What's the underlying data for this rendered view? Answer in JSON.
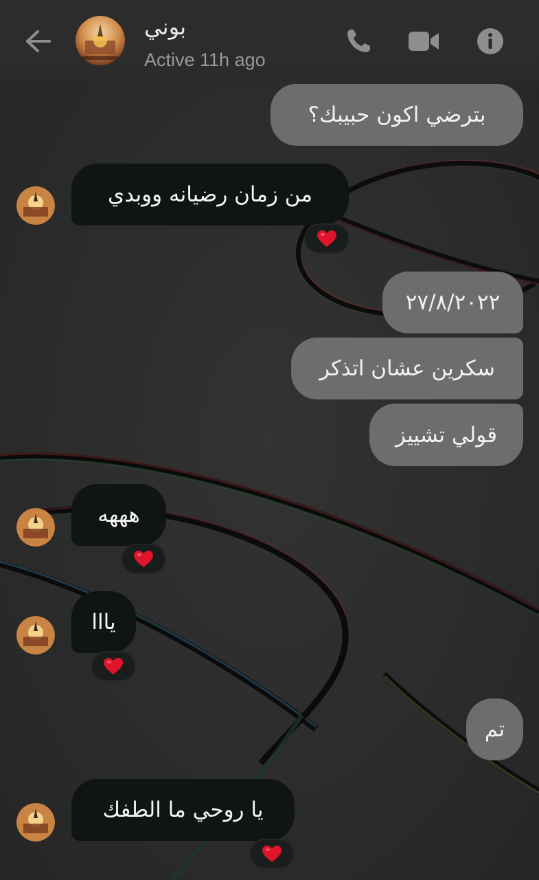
{
  "header": {
    "contact_name": "بوني",
    "status": "Active 11h ago",
    "icons": [
      "back-arrow-icon",
      "phone-icon",
      "video-camera-icon",
      "info-icon"
    ]
  },
  "messages": [
    {
      "direction": "outgoing",
      "text": "بترضي اكون حبيبك؟"
    },
    {
      "direction": "incoming",
      "text": "من زمان رضيانه ووبدي",
      "reaction": "heart"
    },
    {
      "direction": "outgoing",
      "text": "٢٧/٨/٢٠٢٢"
    },
    {
      "direction": "outgoing",
      "text": "سكرين عشان اتذكر"
    },
    {
      "direction": "outgoing",
      "text": "قولي تشييز"
    },
    {
      "direction": "incoming",
      "text": "هههه",
      "reaction": "heart"
    },
    {
      "direction": "incoming",
      "text": "يااا",
      "reaction": "heart"
    },
    {
      "direction": "outgoing",
      "text": "تم"
    },
    {
      "direction": "incoming",
      "text": "يا روحي ما الطفك",
      "reaction": "heart"
    }
  ],
  "colors": {
    "background": "#2a2a2a",
    "outgoing_bubble": "#6d6d6d",
    "incoming_bubble": "#0f1512",
    "reaction_heart": "#e0142b",
    "header_icon": "#8e8e8e"
  }
}
